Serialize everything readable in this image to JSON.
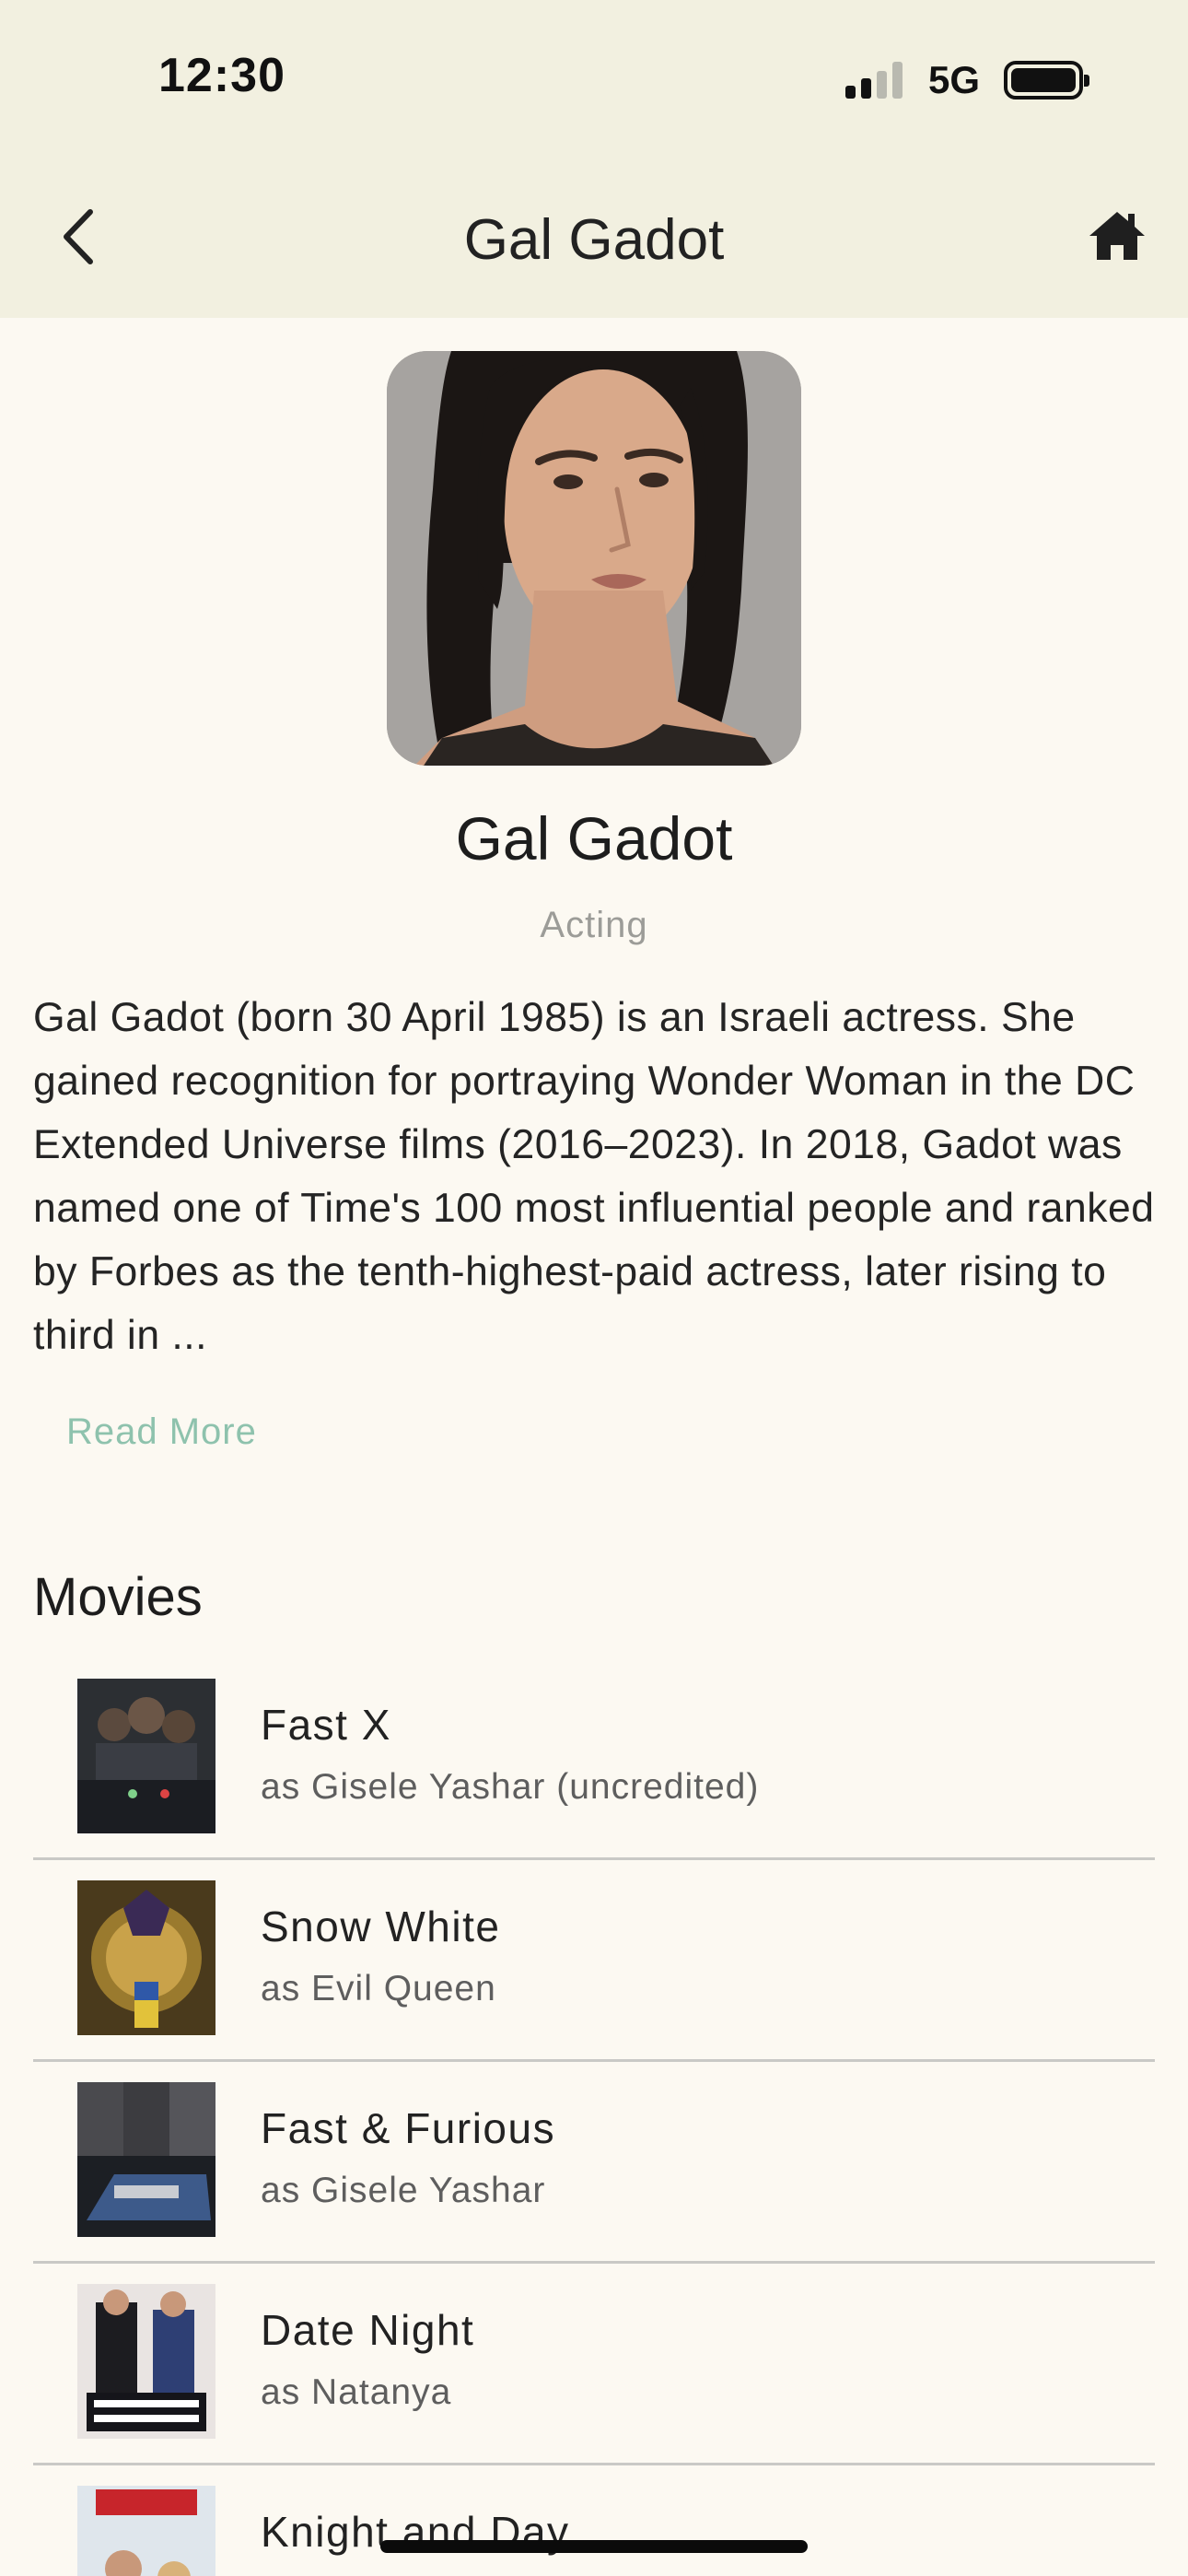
{
  "status_bar": {
    "time": "12:30",
    "network": "5G"
  },
  "nav": {
    "title": "Gal Gadot",
    "back_icon": "chevron-left-icon",
    "home_icon": "home-icon"
  },
  "profile": {
    "name": "Gal Gadot",
    "department": "Acting",
    "bio": "Gal Gadot (born 30 April 1985) is an Israeli actress. She gained recognition for portraying Wonder Woman in the DC Extended Universe films (2016–2023). In 2018, Gadot was named one of Time's 100 most influential people and ranked by Forbes as the tenth-highest-paid actress, later rising to third in ...",
    "read_more": "Read More"
  },
  "movies": {
    "heading": "Movies",
    "items": [
      {
        "title": "Fast X",
        "role": "as Gisele Yashar (uncredited)"
      },
      {
        "title": "Snow White",
        "role": "as Evil Queen"
      },
      {
        "title": "Fast & Furious",
        "role": "as Gisele Yashar"
      },
      {
        "title": "Date Night",
        "role": "as Natanya"
      },
      {
        "title": "Knight and Day",
        "role": ""
      }
    ]
  },
  "colors": {
    "nav_bg": "#f2f0e0",
    "page_bg": "#fcf9f2",
    "accent": "#8ec2ad"
  }
}
